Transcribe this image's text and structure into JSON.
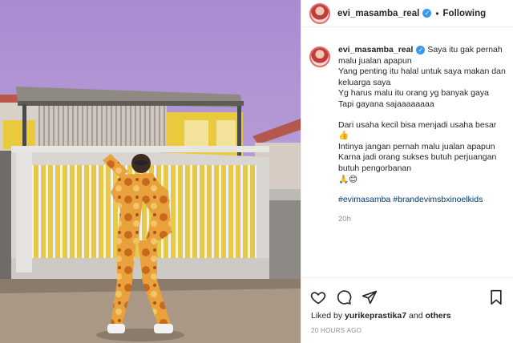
{
  "post": {
    "username": "evi_masamba_real",
    "follow_state": "Following",
    "separator": "•"
  },
  "caption": {
    "username": "evi_masamba_real",
    "line1": "Saya itu gak pernah malu jualan apapun\nYang penting itu halal untuk saya makan dan keluarga saya\nYg harus malu itu orang yg banyak gaya\nTapi gayana sajaaaaaaaa",
    "line2": "Dari usaha kecil bisa menjadi usaha besar👍\nIntinya jangan pernah malu jualan apapun\nKarna jadi orang sukses butuh perjuangan butuh pengorbanan\n🙏😊",
    "hashtags": "#evimasamba #brandevimsbxinoelkids",
    "age": "20h"
  },
  "likes": {
    "prefix": "Liked by ",
    "user": "yurikeprastika7",
    "middle": " and ",
    "others": "others"
  },
  "timestamp": "20 HOURS AGO",
  "icons": {
    "like": "heart-icon",
    "comment": "comment-icon",
    "share": "share-icon",
    "save": "bookmark-icon",
    "verified": "verified-badge-icon"
  },
  "colors": {
    "verified": "#3897f0",
    "hashtag": "#00376b",
    "muted": "#8e8e8e"
  }
}
